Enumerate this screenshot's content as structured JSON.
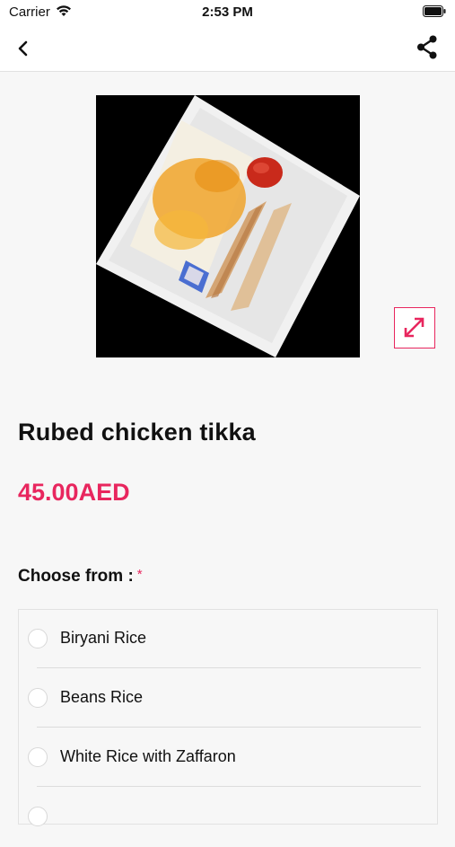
{
  "status_bar": {
    "carrier": "Carrier",
    "time": "2:53 PM"
  },
  "nav": {
    "back_icon": "chevron-left-icon",
    "share_icon": "share-icon"
  },
  "product": {
    "image_description_icon": "food-photo",
    "expand_icon": "expand-arrows-icon",
    "title": "Rubed chicken tikka",
    "price": "45.00AED"
  },
  "options": {
    "label": "Choose from :",
    "required_mark": "*",
    "items": [
      {
        "label": "Biryani Rice",
        "selected": false
      },
      {
        "label": "Beans Rice",
        "selected": false
      },
      {
        "label": "White Rice with Zaffaron",
        "selected": false
      }
    ]
  },
  "colors": {
    "accent": "#e8265e",
    "background": "#f7f7f7"
  }
}
